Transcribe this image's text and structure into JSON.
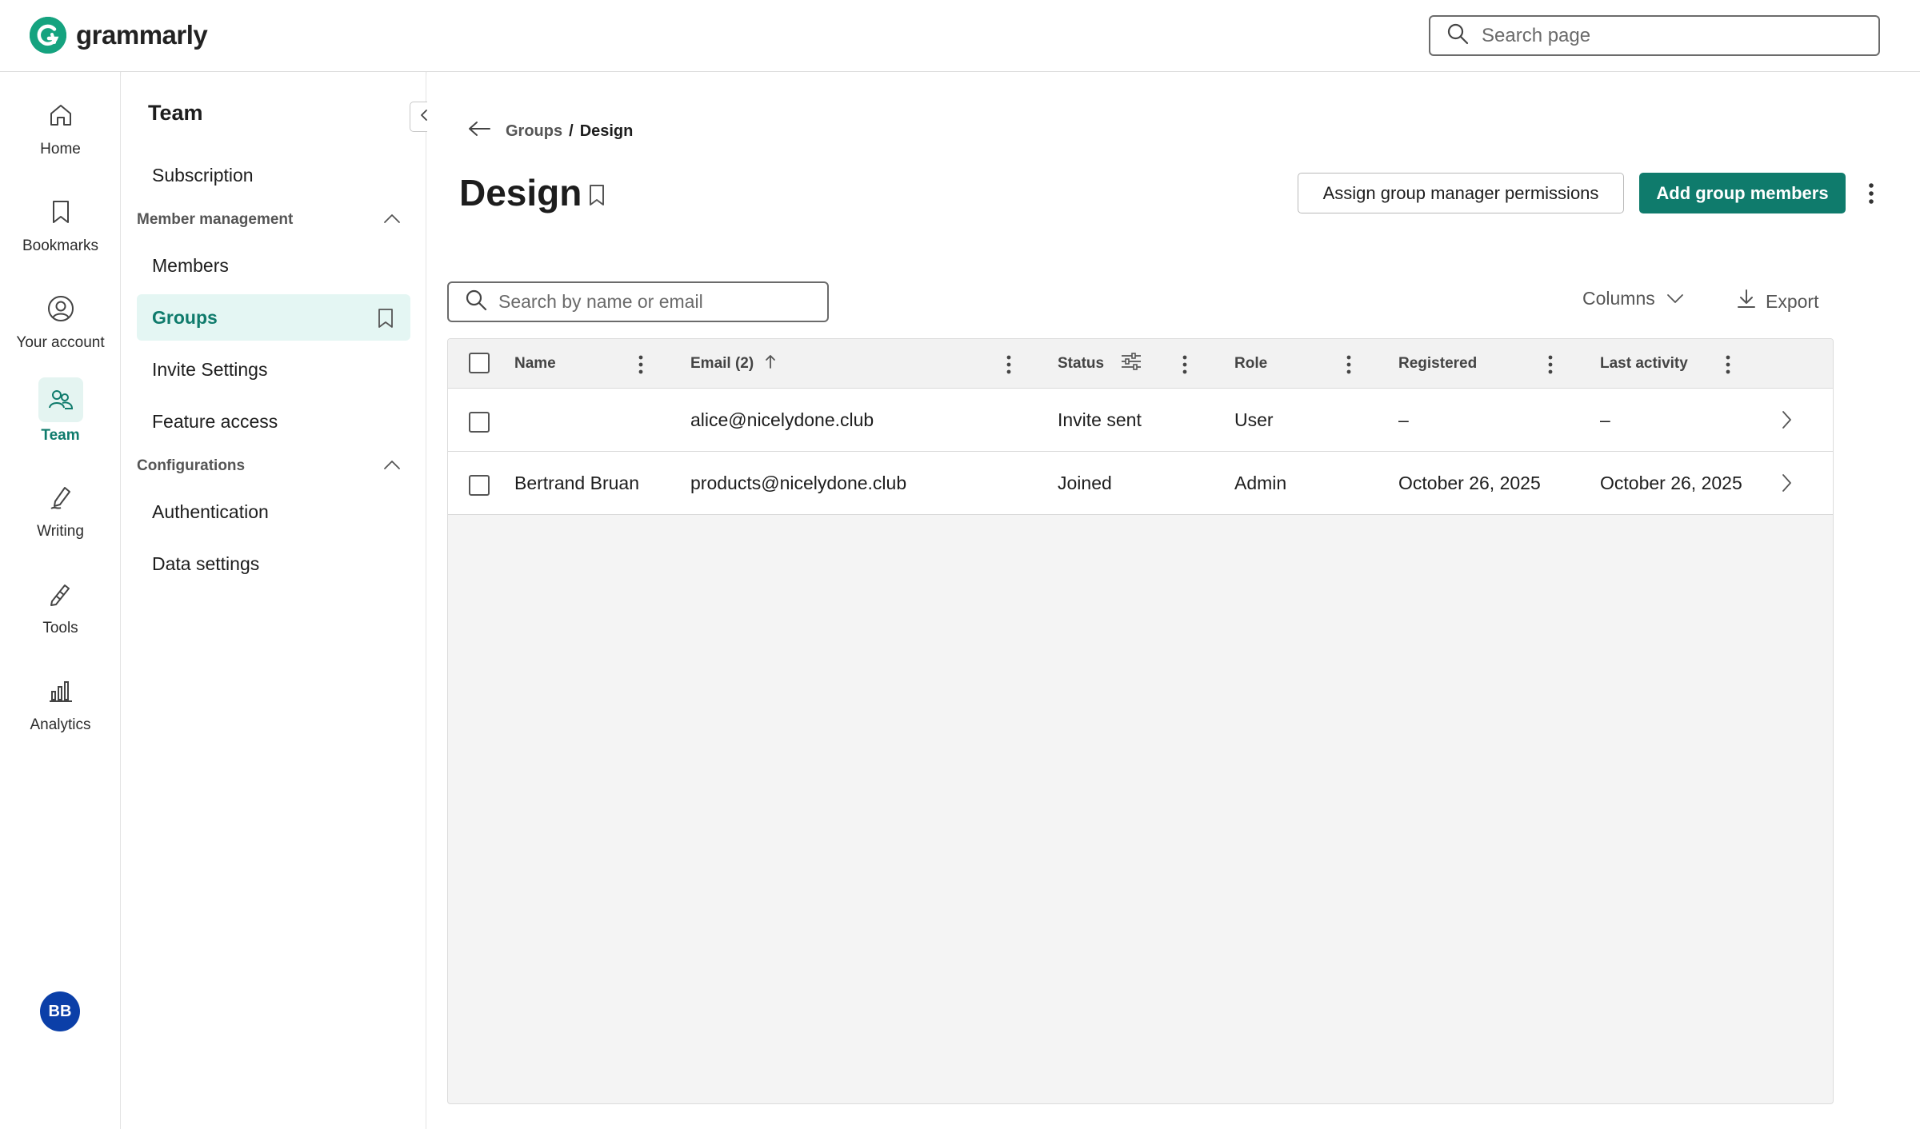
{
  "app": {
    "brand": "grammarly"
  },
  "header": {
    "search_placeholder": "Search page"
  },
  "rail": {
    "items": [
      {
        "label": "Home",
        "icon": "home-icon"
      },
      {
        "label": "Bookmarks",
        "icon": "bookmark-icon"
      },
      {
        "label": "Your account",
        "icon": "account-icon"
      },
      {
        "label": "Team",
        "icon": "team-icon",
        "active": true
      },
      {
        "label": "Writing",
        "icon": "pen-icon"
      },
      {
        "label": "Tools",
        "icon": "tools-icon"
      },
      {
        "label": "Analytics",
        "icon": "analytics-icon"
      }
    ],
    "avatar_initials": "BB"
  },
  "subnav": {
    "title": "Team",
    "subscription": "Subscription",
    "section_member_management": "Member management",
    "members": "Members",
    "groups": "Groups",
    "invite_settings": "Invite Settings",
    "feature_access": "Feature access",
    "section_configurations": "Configurations",
    "authentication": "Authentication",
    "data_settings": "Data settings"
  },
  "main": {
    "breadcrumb": {
      "parent": "Groups",
      "separator": "/",
      "current": "Design"
    },
    "title": "Design",
    "assign_button": "Assign group manager permissions",
    "add_button": "Add group members",
    "table_search_placeholder": "Search by name or email",
    "columns_label": "Columns",
    "export_label": "Export",
    "table": {
      "headers": {
        "name": "Name",
        "email": "Email (2)",
        "status": "Status",
        "role": "Role",
        "registered": "Registered",
        "last_activity": "Last activity"
      },
      "rows": [
        {
          "name": "",
          "email": "alice@nicelydone.club",
          "status": "Invite sent",
          "role": "User",
          "registered": "–",
          "last_activity": "–"
        },
        {
          "name": "Bertrand Bruan",
          "email": "products@nicelydone.club",
          "status": "Joined",
          "role": "Admin",
          "registered": "October 26, 2025",
          "last_activity": "October 26, 2025"
        }
      ]
    }
  },
  "colors": {
    "accent": "#0f7b6c",
    "accent_bg": "#e4f6f3",
    "avatar": "#0b3fa8"
  }
}
